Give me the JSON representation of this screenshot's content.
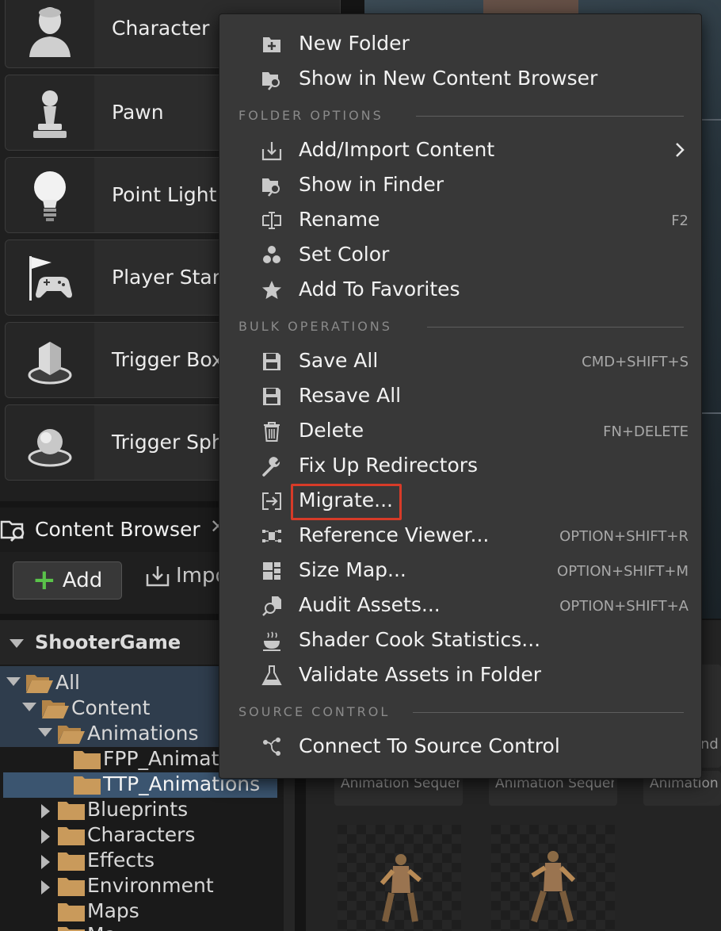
{
  "place_actors": {
    "items": [
      {
        "label": "Character",
        "icon": "character-icon"
      },
      {
        "label": "Pawn",
        "icon": "pawn-icon"
      },
      {
        "label": "Point Light",
        "icon": "point-light-icon"
      },
      {
        "label": "Player Start",
        "icon": "player-start-icon"
      },
      {
        "label": "Trigger Box",
        "icon": "trigger-box-icon"
      },
      {
        "label": "Trigger Sphere",
        "icon": "trigger-sphere-icon"
      }
    ]
  },
  "content_browser": {
    "tab_title": "Content Browser",
    "close_label": "✕",
    "add_label": "Add",
    "import_label": "Import",
    "tree": {
      "root": "ShooterGame",
      "items": [
        {
          "label": "All",
          "expanded": true,
          "selected": false
        },
        {
          "label": "Content",
          "expanded": true,
          "selected": false
        },
        {
          "label": "Animations",
          "expanded": true,
          "selected": false
        },
        {
          "label": "FPP_Animations",
          "expanded": false,
          "selected": false
        },
        {
          "label": "TTP_Animations",
          "expanded": false,
          "selected": true
        },
        {
          "label": "Blueprints",
          "expanded": false,
          "selected": false
        },
        {
          "label": "Characters",
          "expanded": false,
          "selected": false
        },
        {
          "label": "Effects",
          "expanded": false,
          "selected": false
        },
        {
          "label": "Environment",
          "expanded": false,
          "selected": false
        },
        {
          "label": "Maps",
          "expanded": false,
          "selected": false
        },
        {
          "label": "Ma",
          "expanded": false,
          "selected": false
        }
      ]
    },
    "assets": [
      {
        "name": "Animation Sequence"
      },
      {
        "name": "Animation Sequence"
      },
      {
        "name": "Animation Sequence"
      }
    ],
    "asset_partial_text": "nd"
  },
  "context_menu": {
    "items": [
      {
        "label": "New Folder",
        "icon": "new-folder-icon",
        "shortcut": ""
      },
      {
        "label": "Show in New Content Browser",
        "icon": "show-in-content-browser-icon",
        "shortcut": ""
      },
      {
        "label": "Add/Import Content",
        "icon": "import-icon",
        "shortcut": "",
        "submenu": true
      },
      {
        "label": "Show in Finder",
        "icon": "show-in-finder-icon",
        "shortcut": ""
      },
      {
        "label": "Rename",
        "icon": "rename-icon",
        "shortcut": "F2"
      },
      {
        "label": "Set Color",
        "icon": "set-color-icon",
        "shortcut": ""
      },
      {
        "label": "Add To Favorites",
        "icon": "star-icon",
        "shortcut": ""
      },
      {
        "label": "Save All",
        "icon": "save-icon",
        "shortcut": "CMD+SHIFT+S"
      },
      {
        "label": "Resave All",
        "icon": "resave-icon",
        "shortcut": ""
      },
      {
        "label": "Delete",
        "icon": "trash-icon",
        "shortcut": "FN+DELETE"
      },
      {
        "label": "Fix Up Redirectors",
        "icon": "wrench-icon",
        "shortcut": ""
      },
      {
        "label": "Migrate...",
        "icon": "migrate-icon",
        "shortcut": "",
        "highlighted": true
      },
      {
        "label": "Reference Viewer...",
        "icon": "reference-viewer-icon",
        "shortcut": "OPTION+SHIFT+R"
      },
      {
        "label": "Size Map...",
        "icon": "size-map-icon",
        "shortcut": "OPTION+SHIFT+M"
      },
      {
        "label": "Audit Assets...",
        "icon": "audit-icon",
        "shortcut": "OPTION+SHIFT+A"
      },
      {
        "label": "Shader Cook Statistics...",
        "icon": "shader-stats-icon",
        "shortcut": ""
      },
      {
        "label": "Validate Assets in Folder",
        "icon": "flask-icon",
        "shortcut": ""
      },
      {
        "label": "Connect To Source Control",
        "icon": "source-control-icon",
        "shortcut": ""
      }
    ],
    "sections": {
      "folder_options": "FOLDER OPTIONS",
      "bulk_operations": "BULK OPERATIONS",
      "source_control": "SOURCE CONTROL"
    },
    "highlight_color": "#d73b28"
  },
  "colors": {
    "menu_bg": "#383838",
    "selection": "#3b5570",
    "folder": "#c99a5b",
    "add_plus": "#5ac34a"
  }
}
